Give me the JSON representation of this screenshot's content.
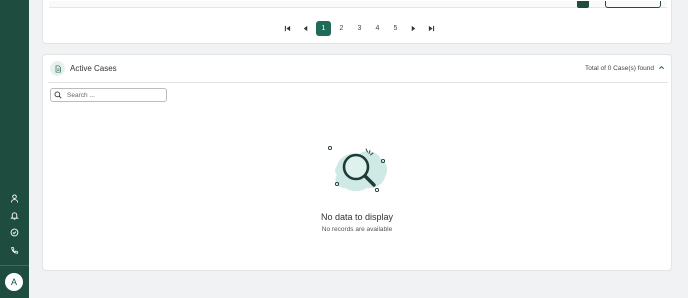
{
  "sidebar": {
    "items": [
      {
        "name": "person",
        "icon": "person-icon"
      },
      {
        "name": "notifications",
        "icon": "bell-icon"
      },
      {
        "name": "approvals",
        "icon": "check-circle-icon"
      },
      {
        "name": "calls",
        "icon": "phone-icon"
      }
    ],
    "avatar_initial": "A",
    "bg_color": "#1e4d3f"
  },
  "pagination": {
    "first_icon": "first-page-icon",
    "prev_icon": "prev-page-icon",
    "pages": [
      "1",
      "2",
      "3",
      "4",
      "5"
    ],
    "current": "1",
    "next_icon": "next-page-icon",
    "last_icon": "last-page-icon",
    "active_color": "#1e6b5a"
  },
  "active_cases": {
    "icon": "document-icon",
    "title": "Active Cases",
    "count_text": "Total of 0 Case(s) found",
    "collapse_icon": "chevron-up-icon",
    "search": {
      "placeholder": "Search ...",
      "value": ""
    },
    "empty": {
      "illustration": "magnifier-illustration",
      "title": "No data to display",
      "subtitle": "No records are available"
    }
  }
}
